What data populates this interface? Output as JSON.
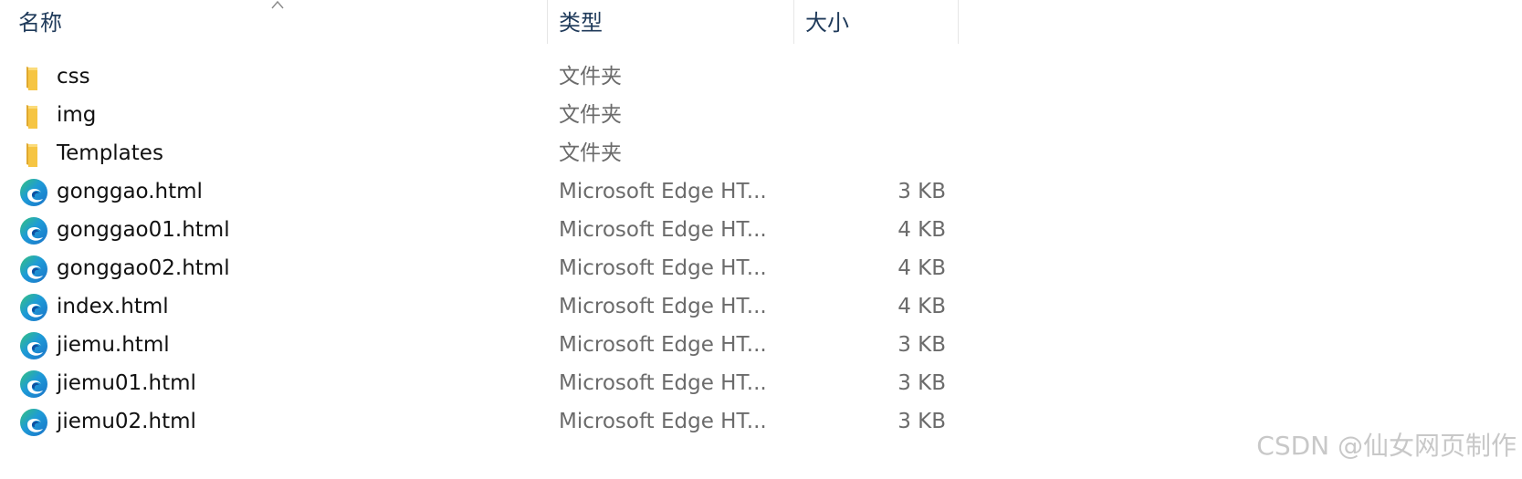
{
  "header": {
    "name_label": "名称",
    "type_label": "类型",
    "size_label": "大小",
    "sort_icon": "sort-ascending-icon"
  },
  "files": [
    {
      "name": "css",
      "type": "文件夹",
      "size": "",
      "icon": "folder-icon"
    },
    {
      "name": "img",
      "type": "文件夹",
      "size": "",
      "icon": "folder-icon"
    },
    {
      "name": "Templates",
      "type": "文件夹",
      "size": "",
      "icon": "folder-icon"
    },
    {
      "name": "gonggao.html",
      "type": "Microsoft Edge HT...",
      "size": "3 KB",
      "icon": "edge-html-icon"
    },
    {
      "name": "gonggao01.html",
      "type": "Microsoft Edge HT...",
      "size": "4 KB",
      "icon": "edge-html-icon"
    },
    {
      "name": "gonggao02.html",
      "type": "Microsoft Edge HT...",
      "size": "4 KB",
      "icon": "edge-html-icon"
    },
    {
      "name": "index.html",
      "type": "Microsoft Edge HT...",
      "size": "4 KB",
      "icon": "edge-html-icon"
    },
    {
      "name": "jiemu.html",
      "type": "Microsoft Edge HT...",
      "size": "3 KB",
      "icon": "edge-html-icon"
    },
    {
      "name": "jiemu01.html",
      "type": "Microsoft Edge HT...",
      "size": "3 KB",
      "icon": "edge-html-icon"
    },
    {
      "name": "jiemu02.html",
      "type": "Microsoft Edge HT...",
      "size": "3 KB",
      "icon": "edge-html-icon"
    }
  ],
  "watermark": "CSDN @仙女网页制作",
  "colors": {
    "folder": "#f6c543",
    "folder_dark": "#e0a82e",
    "edge_blue": "#1b73c8",
    "edge_green": "#36c37a"
  }
}
